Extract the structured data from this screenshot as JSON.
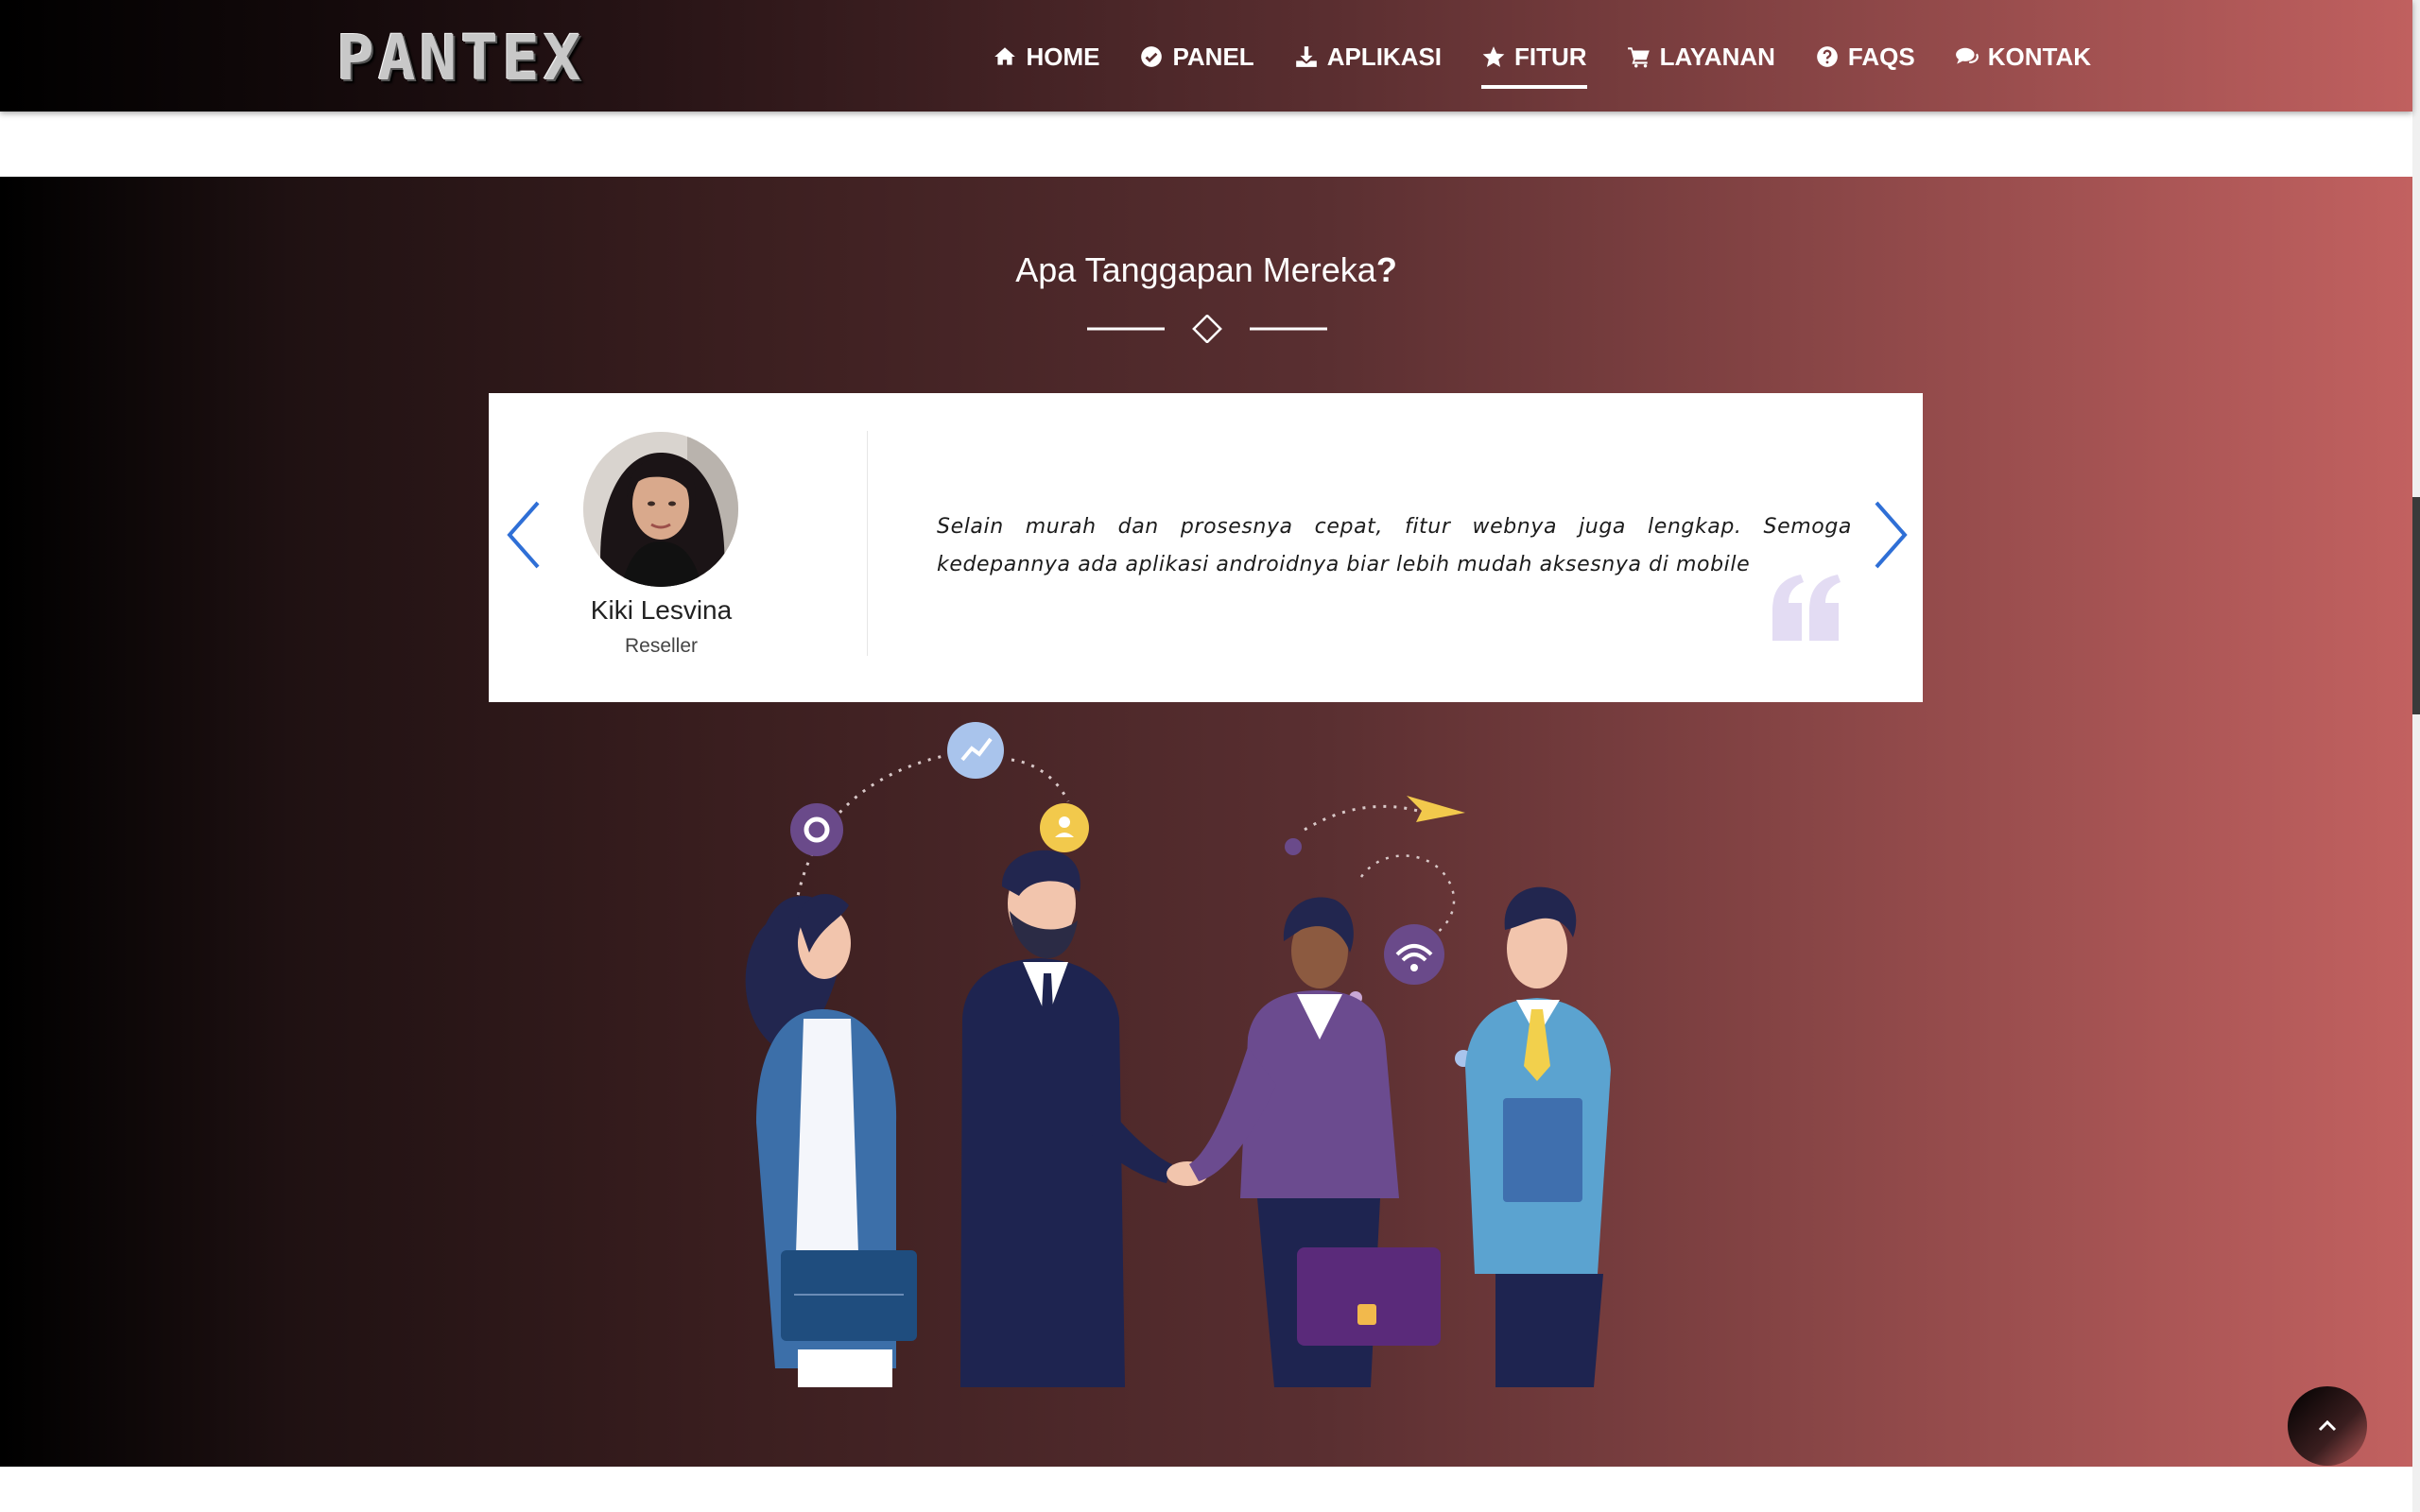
{
  "brand": {
    "logo_text": "PANTEX"
  },
  "nav": {
    "items": [
      {
        "label": "HOME",
        "icon": "home-icon"
      },
      {
        "label": "PANEL",
        "icon": "check-circle-icon"
      },
      {
        "label": "APLIKASI",
        "icon": "download-icon"
      },
      {
        "label": "FITUR",
        "icon": "star-icon",
        "active": true
      },
      {
        "label": "LAYANAN",
        "icon": "cart-icon"
      },
      {
        "label": "FAQS",
        "icon": "question-circle-icon"
      },
      {
        "label": "KONTAK",
        "icon": "chat-icon"
      }
    ]
  },
  "section": {
    "title": "Apa Tanggapan Mereka",
    "title_suffix": "?"
  },
  "testimonial": {
    "name": "Kiki Lesvina",
    "role": "Reseller",
    "quote": "Selain murah dan prosesnya cepat, fitur webnya juga lengkap. Semoga kedepannya ada aplikasi androidnya biar lebih mudah aksesnya di mobile"
  },
  "colors": {
    "accent_arrow": "#2f6fd6",
    "quote_mark": "#e3dcf3",
    "gradient_start": "#000000",
    "gradient_end": "#c26160"
  }
}
